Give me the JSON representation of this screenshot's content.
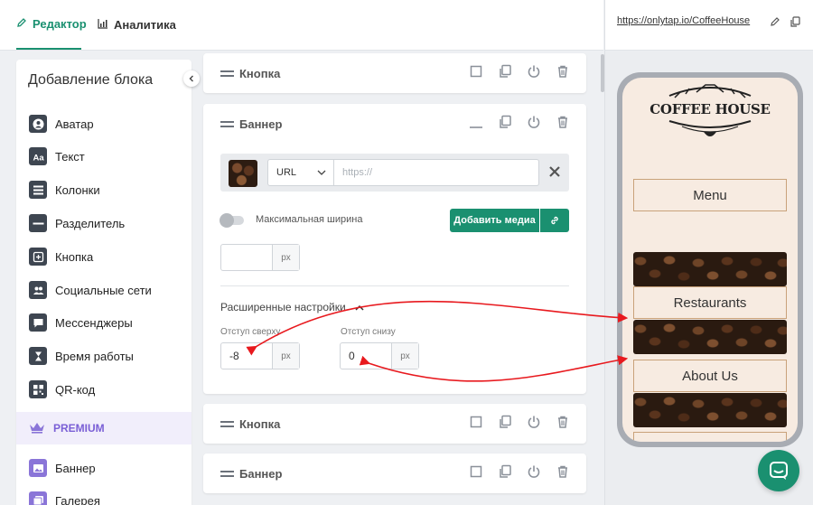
{
  "tabs": {
    "editor": "Редактор",
    "analytics": "Аналитика"
  },
  "sidebar": {
    "title": "Добавление блока",
    "items": [
      "Аватар",
      "Текст",
      "Колонки",
      "Разделитель",
      "Кнопка",
      "Социальные сети",
      "Мессенджеры",
      "Время работы",
      "QR-код"
    ],
    "premium": "PREMIUM",
    "premium_items": [
      "Баннер",
      "Галерея"
    ]
  },
  "blocks": {
    "button1": "Кнопка",
    "banner": "Баннер",
    "button2": "Кнопка",
    "banner2": "Баннер"
  },
  "banner_settings": {
    "url_type": "URL",
    "url_placeholder": "https://",
    "max_width_label": "Максимальная ширина",
    "add_media": "Добавить медиа",
    "width_value": "",
    "unit": "px",
    "advanced_title": "Расширенные настройки",
    "top_label": "Отступ сверху",
    "top_value": "-8",
    "bottom_label": "Отступ снизу",
    "bottom_value": "0"
  },
  "preview": {
    "url": "https://onlytap.io/CoffeeHouse",
    "logo_text": "COFFEE HOUSE",
    "buttons": [
      "Menu",
      "Restaurants",
      "About Us"
    ]
  },
  "colors": {
    "accent": "#1a9070",
    "premium": "#7a5fd6",
    "arrow": "#e8191e"
  }
}
